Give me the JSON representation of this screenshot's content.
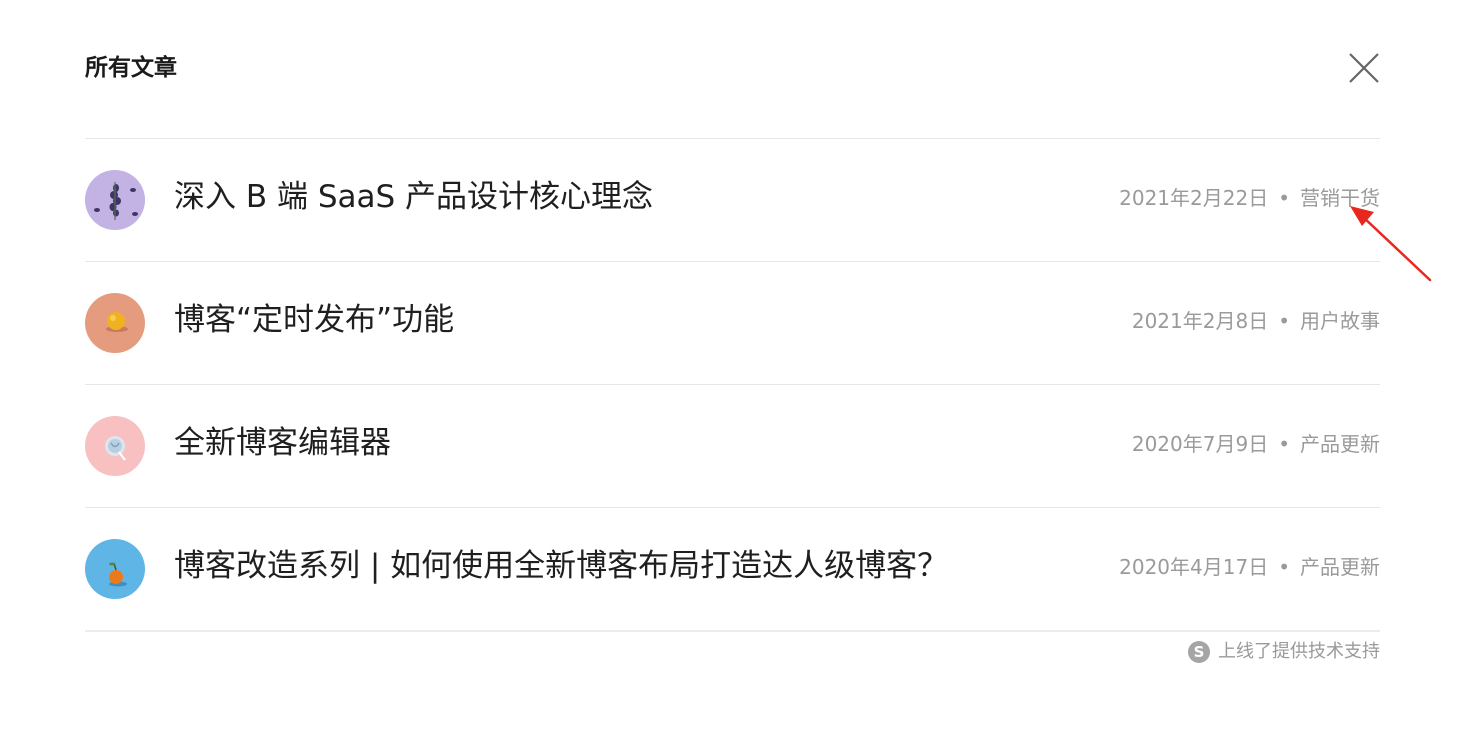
{
  "modal": {
    "title": "所有文章",
    "close_icon": "close-icon"
  },
  "posts": [
    {
      "title": "深入 B 端 SaaS 产品设计核心理念",
      "date": "2021年2月22日",
      "separator": "•",
      "category": "营销干货",
      "thumb_icon": "lavender-thumbnail",
      "thumb_color": "#c3b2e4"
    },
    {
      "title": "博客“定时发布”功能",
      "date": "2021年2月8日",
      "separator": "•",
      "category": "用户故事",
      "thumb_icon": "fruit-thumbnail",
      "thumb_color": "#e59c7e"
    },
    {
      "title": "全新博客编辑器",
      "date": "2020年7月9日",
      "separator": "•",
      "category": "产品更新",
      "thumb_icon": "lollipop-thumbnail",
      "thumb_color": "#f8c0c0"
    },
    {
      "title": "博客改造系列 | 如何使用全新博客布局打造达人级博客？",
      "date": "2020年4月17日",
      "separator": "•",
      "category": "产品更新",
      "thumb_icon": "tangerine-thumbnail",
      "thumb_color": "#5fb6e6"
    }
  ],
  "footer": {
    "logo_letter": "S",
    "text": "上线了提供技术支持"
  },
  "annotation": {
    "arrow_color": "#e8281e"
  }
}
